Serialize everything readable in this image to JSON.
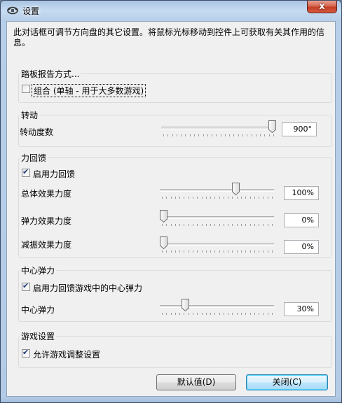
{
  "window": {
    "title": "设置",
    "close_glyph": "x"
  },
  "description": "此对话框可调节方向盘的其它设置。将鼠标光标移动到控件上可获取有关其作用的信息。",
  "pedals": {
    "title": "踏板报告方式...",
    "combined_checkbox": {
      "label": "组合 (单轴 - 用于大多数游戏)",
      "checked": false
    }
  },
  "rotation": {
    "title": "转动",
    "degrees_label": "转动度数",
    "degrees_value": "900°",
    "degrees_level": 1.0
  },
  "force_feedback": {
    "title": "力回馈",
    "enable_checkbox": {
      "label": "启用力回馈",
      "checked": true
    },
    "overall_label": "总体效果力度",
    "overall_value": "100%",
    "overall_level": 0.67,
    "spring_label": "弹力效果力度",
    "spring_value": "0%",
    "spring_level": 0.0,
    "damper_label": "减振效果力度",
    "damper_value": "0%",
    "damper_level": 0.0
  },
  "centering": {
    "title": "中心弹力",
    "enable_checkbox": {
      "label": "启用力回馈游戏中的中心弹力",
      "checked": true
    },
    "strength_label": "中心弹力",
    "strength_value": "30%",
    "strength_level": 0.2
  },
  "game_settings": {
    "title": "游戏设置",
    "allow_checkbox": {
      "label": "允许游戏调整设置",
      "checked": true
    }
  },
  "buttons": {
    "defaults": "默认值(D)",
    "close": "关闭(C)"
  },
  "colors": {
    "accent_tick": "#1b3f7a",
    "titlebar": "#b3cbe6",
    "close_red": "#c33f26"
  }
}
